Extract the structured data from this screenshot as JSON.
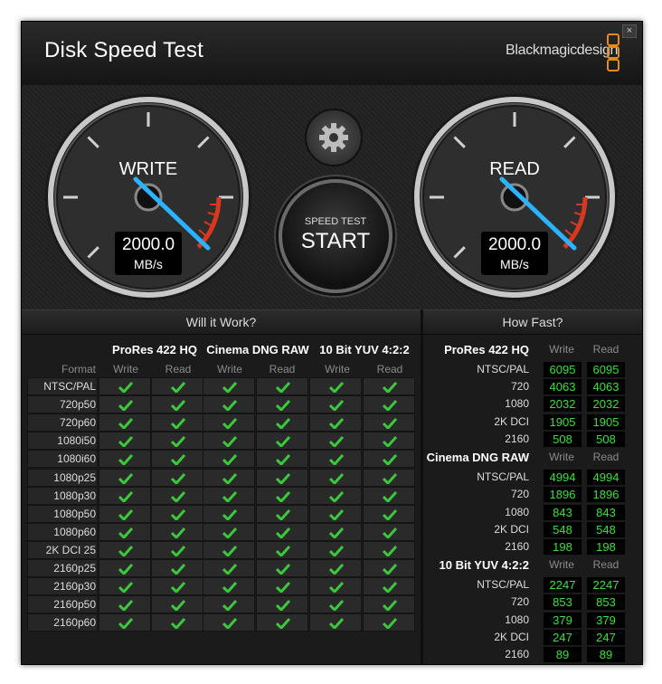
{
  "app": {
    "title": "Disk Speed Test",
    "brand": "Blackmagicdesign",
    "close_glyph": "×"
  },
  "gauges": {
    "write": {
      "label": "WRITE",
      "value": "2000.0",
      "unit": "MB/s"
    },
    "read": {
      "label": "READ",
      "value": "2000.0",
      "unit": "MB/s"
    }
  },
  "start_button": {
    "sub_label": "SPEED TEST",
    "label": "START"
  },
  "settings_icon": "gear-icon",
  "will_it_work": {
    "title": "Will it Work?",
    "row_header": "Format",
    "groups": [
      "ProRes 422 HQ",
      "Cinema DNG RAW",
      "10 Bit YUV 4:2:2"
    ],
    "sub_headers": [
      "Write",
      "Read",
      "Write",
      "Read",
      "Write",
      "Read"
    ],
    "formats": [
      "NTSC/PAL",
      "720p50",
      "720p60",
      "1080i50",
      "1080i60",
      "1080p25",
      "1080p30",
      "1080p50",
      "1080p60",
      "2K DCI 25",
      "2160p25",
      "2160p30",
      "2160p50",
      "2160p60"
    ],
    "all_supported": true
  },
  "how_fast": {
    "title": "How Fast?",
    "groups": [
      {
        "name": "ProRes 422 HQ",
        "write_label": "Write",
        "read_label": "Read",
        "rows": [
          {
            "format": "NTSC/PAL",
            "write": "6095",
            "read": "6095"
          },
          {
            "format": "720",
            "write": "4063",
            "read": "4063"
          },
          {
            "format": "1080",
            "write": "2032",
            "read": "2032"
          },
          {
            "format": "2K DCI",
            "write": "1905",
            "read": "1905"
          },
          {
            "format": "2160",
            "write": "508",
            "read": "508"
          }
        ]
      },
      {
        "name": "Cinema DNG RAW",
        "write_label": "Write",
        "read_label": "Read",
        "rows": [
          {
            "format": "NTSC/PAL",
            "write": "4994",
            "read": "4994"
          },
          {
            "format": "720",
            "write": "1896",
            "read": "1896"
          },
          {
            "format": "1080",
            "write": "843",
            "read": "843"
          },
          {
            "format": "2K DCI",
            "write": "548",
            "read": "548"
          },
          {
            "format": "2160",
            "write": "198",
            "read": "198"
          }
        ]
      },
      {
        "name": "10 Bit YUV 4:2:2",
        "write_label": "Write",
        "read_label": "Read",
        "rows": [
          {
            "format": "NTSC/PAL",
            "write": "2247",
            "read": "2247"
          },
          {
            "format": "720",
            "write": "853",
            "read": "853"
          },
          {
            "format": "1080",
            "write": "379",
            "read": "379"
          },
          {
            "format": "2K DCI",
            "write": "247",
            "read": "247"
          },
          {
            "format": "2160",
            "write": "89",
            "read": "89"
          }
        ]
      }
    ]
  },
  "colors": {
    "value_green": "#35e335",
    "check_green": "#3cc83c",
    "accent_orange": "#e58a1f",
    "needle_blue": "#2ab4ff"
  }
}
